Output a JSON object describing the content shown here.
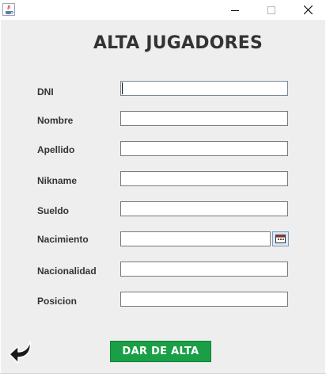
{
  "window": {
    "app_icon": "java-cup-icon",
    "controls": {
      "minimize": "minimize-icon",
      "maximize": "maximize-icon",
      "close": "close-icon"
    }
  },
  "form": {
    "title": "ALTA JUGADORES",
    "fields": [
      {
        "label": "DNI",
        "value": ""
      },
      {
        "label": "Nombre",
        "value": ""
      },
      {
        "label": "Apellido",
        "value": ""
      },
      {
        "label": "Nikname",
        "value": ""
      },
      {
        "label": "Sueldo",
        "value": ""
      },
      {
        "label": "Nacimiento",
        "value": ""
      },
      {
        "label": "Nacionalidad",
        "value": ""
      },
      {
        "label": "Posicion",
        "value": ""
      }
    ],
    "calendar_icon": "calendar-icon",
    "back_icon": "back-arrow-icon",
    "submit_label": "DAR DE ALTA",
    "submit_color": "#1a9f46"
  }
}
